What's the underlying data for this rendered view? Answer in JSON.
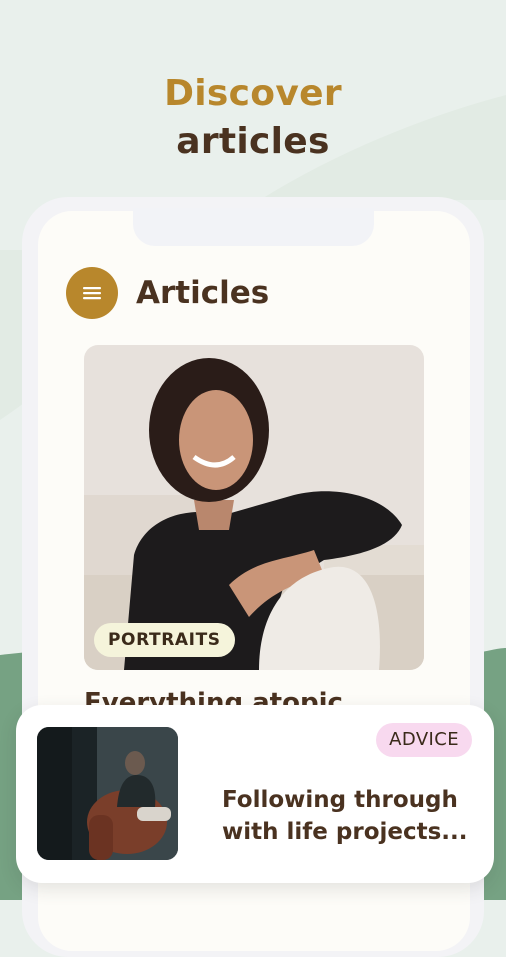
{
  "headline": {
    "line1": "Discover",
    "line2": "articles"
  },
  "screen": {
    "menu_icon": "hamburger-menu-icon",
    "title": "Articles"
  },
  "featured_article": {
    "tag": "PORTRAITS",
    "title": "Everything atopic"
  },
  "secondary_article": {
    "tag": "ADVICE",
    "title": "Following through with life projects..."
  },
  "colors": {
    "accent": "#b8872c",
    "text_dark": "#4a3220",
    "background": "#e9f0ec",
    "wave": "#76a283",
    "tag_portraits_bg": "#f5f4db",
    "tag_advice_bg": "#f8d9ef"
  }
}
